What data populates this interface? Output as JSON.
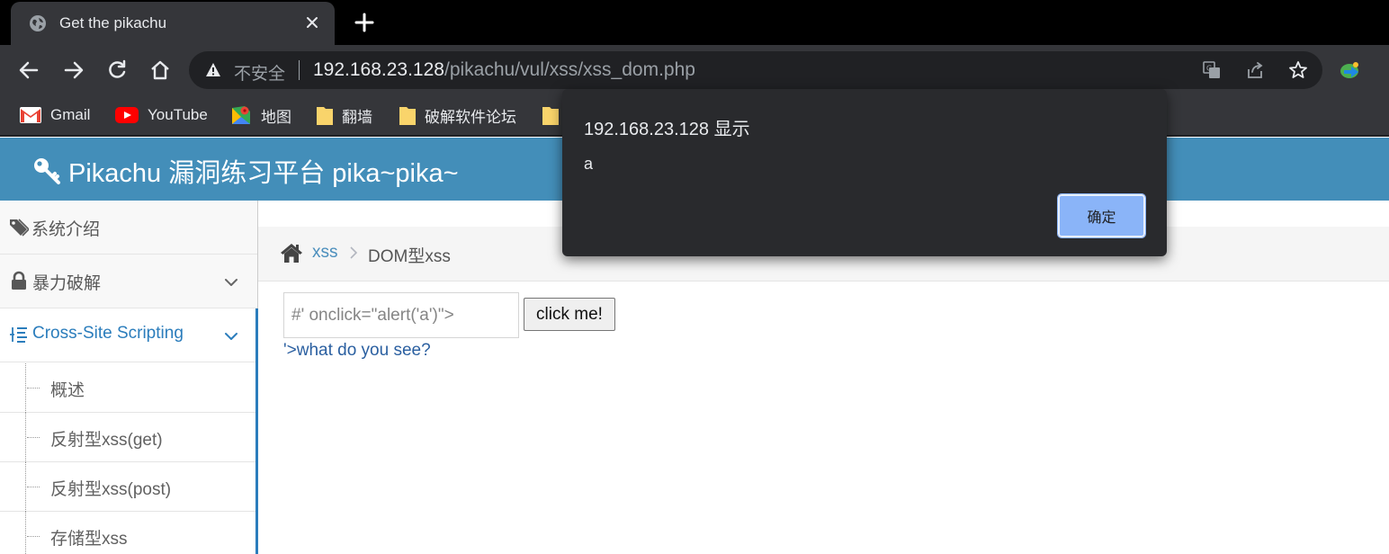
{
  "browser": {
    "tab": {
      "title": "Get the pikachu"
    },
    "omnibox": {
      "security_label": "不安全",
      "url_host": "192.168.23.128",
      "url_path": "/pikachu/vul/xss/xss_dom.php"
    },
    "bookmarks": [
      {
        "label": "Gmail",
        "icon": "gmail-icon"
      },
      {
        "label": "YouTube",
        "icon": "youtube-icon"
      },
      {
        "label": "地图",
        "icon": "maps-icon"
      },
      {
        "label": "翻墙",
        "icon": "folder-icon"
      },
      {
        "label": "破解软件论坛",
        "icon": "folder-icon"
      }
    ]
  },
  "page": {
    "brand": "Pikachu 漏洞练习平台 pika~pika~",
    "sidebar": {
      "items": [
        {
          "label": "系统介绍",
          "icon": "tags-icon"
        },
        {
          "label": "暴力破解",
          "icon": "lock-icon"
        },
        {
          "label": "Cross-Site Scripting",
          "icon": "list-icon"
        }
      ],
      "submenu": [
        "概述",
        "反射型xss(get)",
        "反射型xss(post)",
        "存储型xss"
      ]
    },
    "breadcrumb": {
      "link": "xss",
      "current": "DOM型xss"
    },
    "form": {
      "input_value": "#' onclick=\"alert('a')\">",
      "button_label": "click me!",
      "result_text": "'>what do you see?"
    }
  },
  "dialog": {
    "title": "192.168.23.128 显示",
    "message": "a",
    "ok_label": "确定"
  },
  "colors": {
    "navbar": "#438eb9",
    "active_link": "#2b7dbc",
    "dialog_bg": "#292a2d",
    "dialog_button": "#8ab4f8"
  }
}
